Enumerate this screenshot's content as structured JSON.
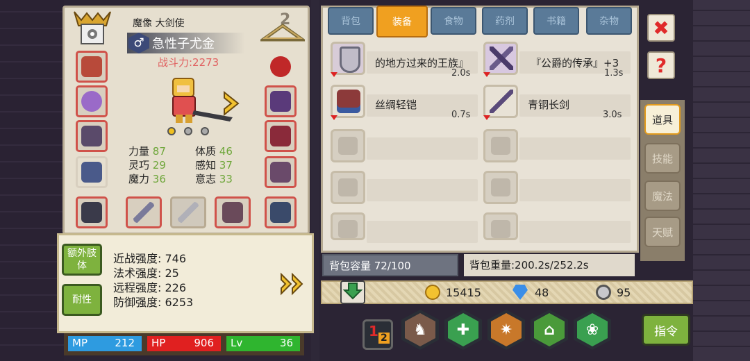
{
  "character": {
    "title": "魔像 大剑使",
    "name": "急性子尤金",
    "gender_symbol": "♂",
    "combat_power": "战斗力:2273",
    "attributes": [
      {
        "label": "力量",
        "value": "87"
      },
      {
        "label": "体质",
        "value": "46"
      },
      {
        "label": "灵巧",
        "value": "29"
      },
      {
        "label": "感知",
        "value": "37"
      },
      {
        "label": "魔力",
        "value": "36"
      },
      {
        "label": "意志",
        "value": "33"
      }
    ],
    "strength": [
      {
        "text": "近战强度: 746"
      },
      {
        "text": "法术强度: 25"
      },
      {
        "text": "远程强度: 226"
      },
      {
        "text": "防御强度: 6253"
      }
    ],
    "buttons": {
      "extra_limb": "额外肢体",
      "endurance": "耐性"
    },
    "bars": {
      "mp_label": "MP",
      "mp": "212",
      "hp_label": "HP",
      "hp": "906",
      "lv_label": "Lv",
      "lv": "36"
    }
  },
  "tabs": [
    {
      "label": "背包"
    },
    {
      "label": "装备"
    },
    {
      "label": "食物"
    },
    {
      "label": "药剂"
    },
    {
      "label": "书籍"
    },
    {
      "label": "杂物"
    }
  ],
  "items": [
    {
      "name": "的地方过来的王族』",
      "weight": "2.0s",
      "color": "#7a7f8c"
    },
    {
      "name": "『公爵的传承』+3",
      "weight": "1.3s",
      "color": "#6b3f8c"
    },
    {
      "name": "丝绸轻铠",
      "weight": "0.7s",
      "color": "#8c3a3a"
    },
    {
      "name": "青铜长剑",
      "weight": "3.0s",
      "color": "#5a4a7a"
    }
  ],
  "side_tabs": [
    {
      "label": "道具"
    },
    {
      "label": "技能"
    },
    {
      "label": "魔法"
    },
    {
      "label": "天赋"
    }
  ],
  "inventory": {
    "capacity": "背包容量 72/100",
    "weight": "背包重量:200.2s/252.2s"
  },
  "currency": {
    "gold": "15415",
    "gems": "48",
    "silver": "95"
  },
  "command_label": "指令",
  "colors": {
    "accent_orange": "#f0a020",
    "button_green": "#7eb23e",
    "mp_blue": "#2e9be0",
    "hp_red": "#e02020",
    "lv_green": "#2fb52f"
  }
}
